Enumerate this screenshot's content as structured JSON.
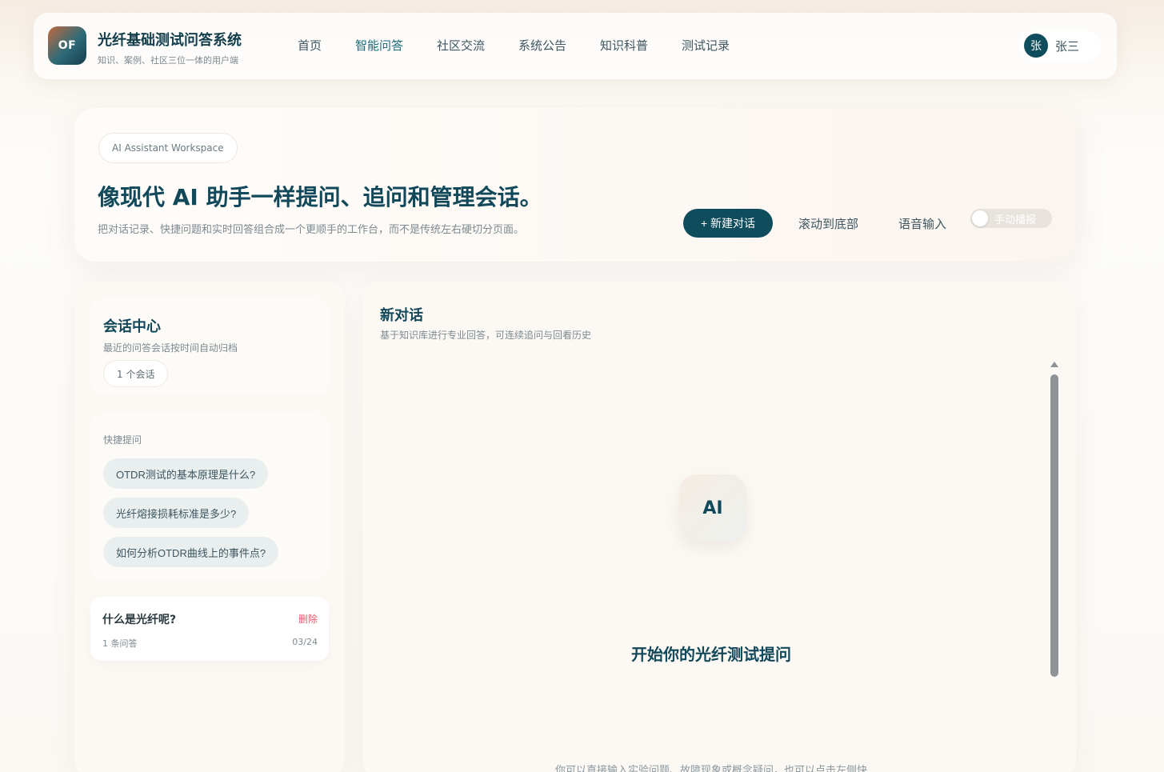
{
  "header": {
    "logo_text": "OF",
    "title": "光纤基础测试问答系统",
    "subtitle": "知识、案例、社区三位一体的用户端",
    "nav": [
      {
        "label": "首页"
      },
      {
        "label": "智能问答"
      },
      {
        "label": "社区交流"
      },
      {
        "label": "系统公告"
      },
      {
        "label": "知识科普"
      },
      {
        "label": "测试记录"
      }
    ],
    "user": {
      "avatar_char": "张",
      "name": "张三"
    }
  },
  "hero": {
    "tag": "AI Assistant Workspace",
    "title": "像现代 AI 助手一样提问、追问和管理会话。",
    "description": "把对话记录、快捷问题和实时回答组合成一个更顺手的工作台，而不是传统左右硬切分页面。",
    "new_chat_label": "+ 新建对话",
    "scroll_bottom_label": "滚动到底部",
    "voice_input_label": "语音输入",
    "manual_toggle_label": "手动播报"
  },
  "sessions": {
    "title": "会话中心",
    "subtitle": "最近的问答会话按时间自动归档",
    "count_label": "1 个会话",
    "quick_label": "快捷提问",
    "quick_questions": [
      "OTDR测试的基本原理是什么?",
      "光纤熔接损耗标准是多少?",
      "如何分析OTDR曲线上的事件点?"
    ],
    "history": [
      {
        "title": "什么是光纤呢?",
        "delete_label": "删除",
        "count": "1 条问答",
        "date": "03/24"
      }
    ]
  },
  "chat": {
    "title": "新对话",
    "subtitle": "基于知识库进行专业回答，可连续追问与回看历史",
    "ai_badge": "AI",
    "empty_title": "开始你的光纤测试提问",
    "empty_hint": "你可以直接输入实验问题、故障现象或概念疑问，也可以点击左侧快"
  },
  "colors": {
    "primary": "#0f4c5c",
    "danger": "#e45a6b"
  }
}
